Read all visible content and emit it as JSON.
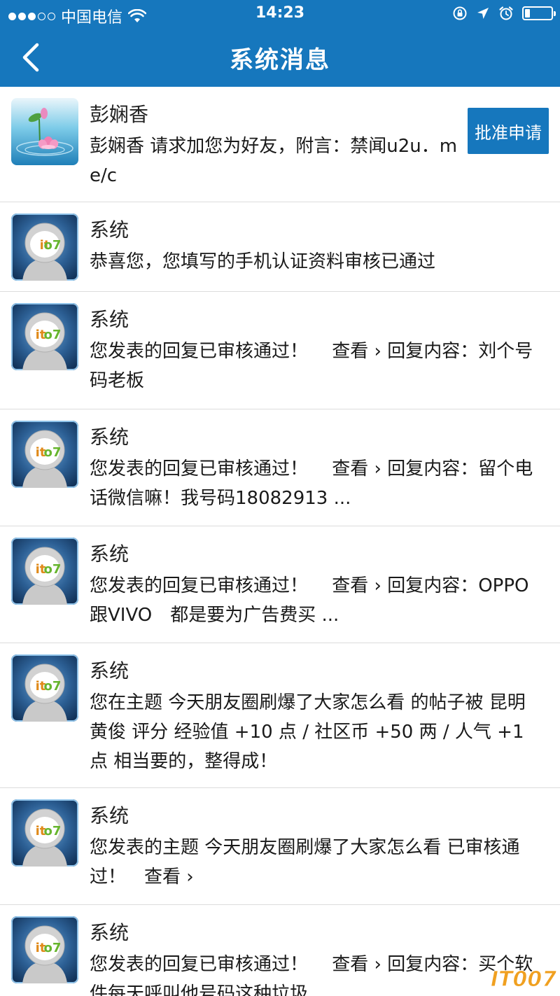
{
  "status_bar": {
    "carrier": "中国电信",
    "time": "14:23"
  },
  "nav": {
    "title": "系统消息"
  },
  "messages": [
    {
      "sender": "彭娴香",
      "content": "彭娴香 请求加您为好友，附言：禁闻u2u．me/c",
      "action_label": "批准申请"
    },
    {
      "sender": "系统",
      "content": "恭喜您，您填写的手机认证资料审核已通过"
    },
    {
      "sender": "系统",
      "content": "您发表的回复已审核通过！　 查看 › 回复内容：刘个号码老板"
    },
    {
      "sender": "系统",
      "content": "您发表的回复已审核通过！　 查看 › 回复内容：留个电话微信嘛！我号码18082913 ..."
    },
    {
      "sender": "系统",
      "content": "您发表的回复已审核通过！　 查看 › 回复内容：OPPO跟VIVO　都是要为广告费买 ..."
    },
    {
      "sender": "系统",
      "content": "您在主题 今天朋友圈刷爆了大家怎么看 的帖子被 昆明黄俊 评分 经验值 +10 点 / 社区币 +50 两 / 人气 +1 点 相当要的，整得成！"
    },
    {
      "sender": "系统",
      "content": "您发表的主题 今天朋友圈刷爆了大家怎么看 已审核通过！　查看 ›"
    },
    {
      "sender": "系统",
      "content": "您发表的回复已审核通过！　 查看 › 回复内容：买个软件每天呼叫他号码这种垃圾"
    }
  ],
  "watermark": {
    "text": "IT007"
  },
  "colors": {
    "header_bg": "#1677bd",
    "divider": "#dcdcdc",
    "watermark": "#f0a020"
  },
  "icons": {
    "back": "chevron-left-icon",
    "wifi": "wifi-icon",
    "lock_rotation": "rotation-lock-icon",
    "location": "location-arrow-icon",
    "alarm": "alarm-clock-icon",
    "battery": "battery-icon",
    "avatar_user": "lotus-avatar",
    "avatar_system": "it007-mascot-avatar"
  },
  "battery_level": 0.2
}
